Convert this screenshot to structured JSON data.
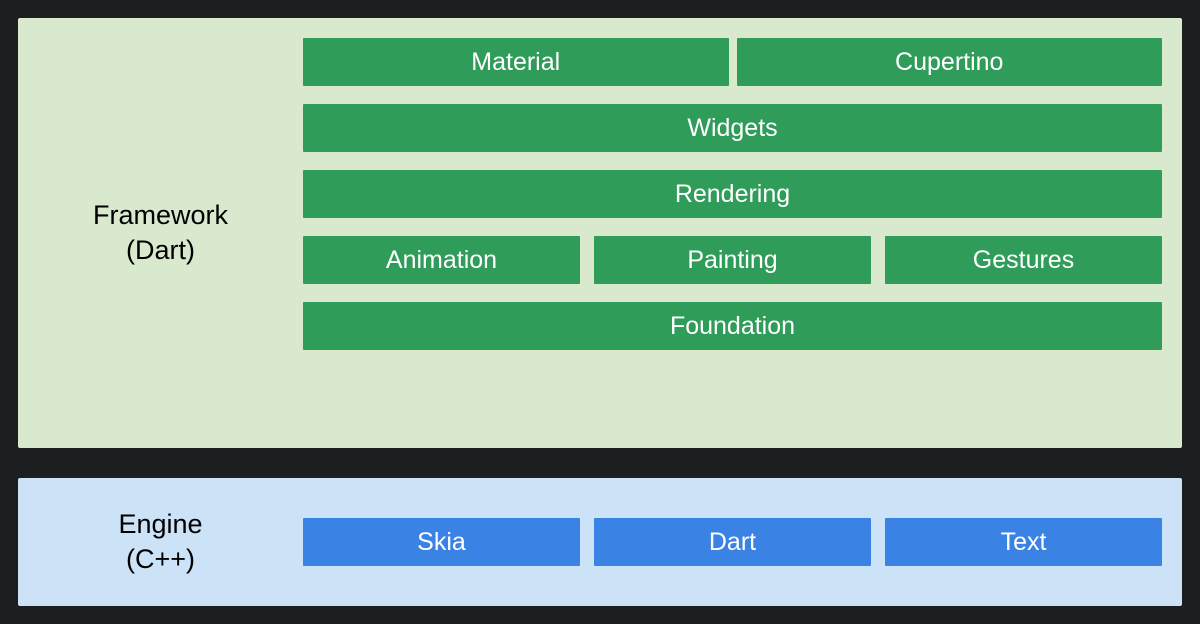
{
  "framework": {
    "label_line1": "Framework",
    "label_line2": "(Dart)",
    "rows": {
      "top": {
        "material": "Material",
        "cupertino": "Cupertino"
      },
      "widgets": "Widgets",
      "rendering": "Rendering",
      "mid": {
        "animation": "Animation",
        "painting": "Painting",
        "gestures": "Gestures"
      },
      "foundation": "Foundation"
    }
  },
  "engine": {
    "label_line1": "Engine",
    "label_line2": "(C++)",
    "items": {
      "skia": "Skia",
      "dart": "Dart",
      "text": "Text"
    }
  },
  "colors": {
    "bg": "#1d1e1f",
    "framework_bg": "#d8e9ce",
    "engine_bg": "#cce2f6",
    "green": "#2f9c5a",
    "blue": "#3a82e4"
  }
}
